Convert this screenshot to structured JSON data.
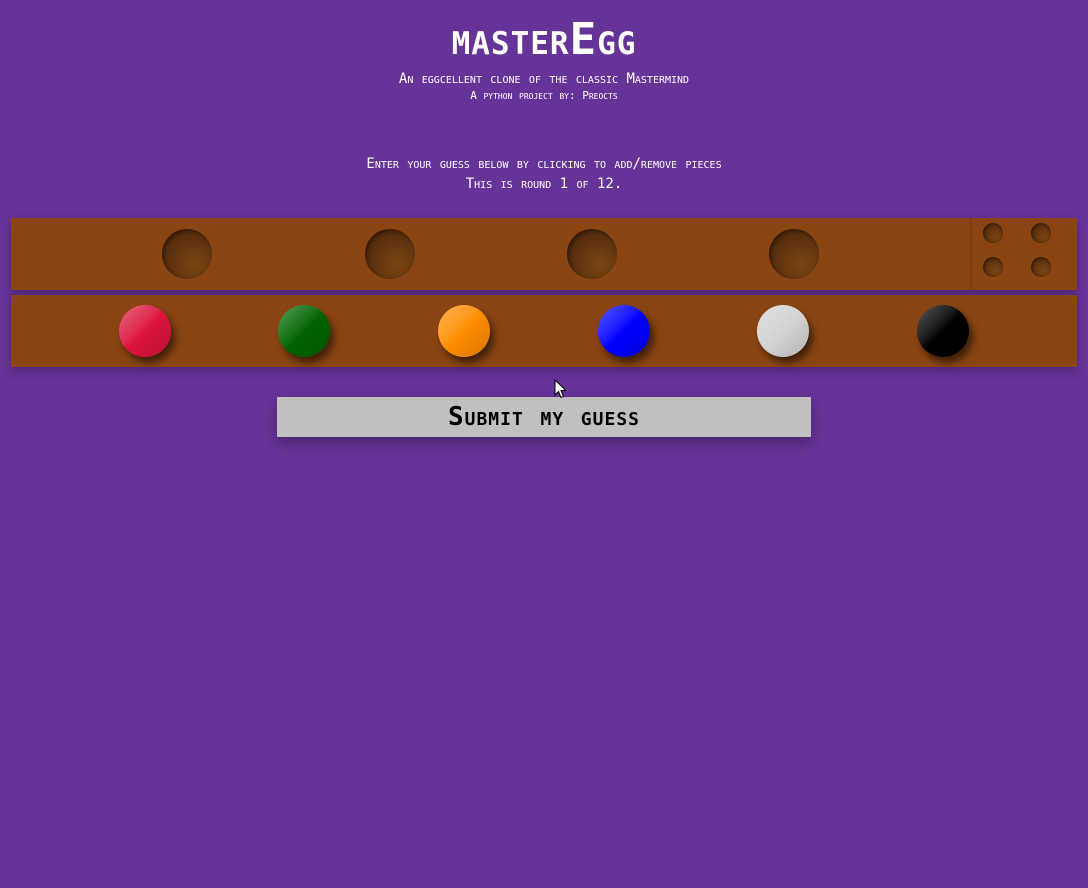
{
  "header": {
    "title": "masterEgg",
    "subtitle": "An eggcellent clone of the classic Mastermind",
    "byline": "A python project by: Preocts"
  },
  "instructions": {
    "line1": "Enter your guess below by clicking to add/remove pieces",
    "line2": "This is round 1 of 12."
  },
  "round": {
    "current": 1,
    "total": 12
  },
  "guess_row": {
    "slots": 4,
    "filled": [],
    "feedback_pegs": 4
  },
  "palette": {
    "colors": [
      {
        "name": "crimson",
        "hex": "#dc143c",
        "icon": "red-peg"
      },
      {
        "name": "green",
        "hex": "#006400",
        "icon": "green-peg"
      },
      {
        "name": "orange",
        "hex": "#ff8c00",
        "icon": "orange-peg"
      },
      {
        "name": "blue",
        "hex": "#0000ff",
        "icon": "blue-peg"
      },
      {
        "name": "silver",
        "hex": "#d3d3d3",
        "icon": "silver-peg"
      },
      {
        "name": "black",
        "hex": "#000000",
        "icon": "black-peg"
      }
    ]
  },
  "submit_button": {
    "label": "Submit my guess"
  },
  "theme": {
    "background": "#663399",
    "board": "#8b4513",
    "button": "#c0c0c0"
  }
}
